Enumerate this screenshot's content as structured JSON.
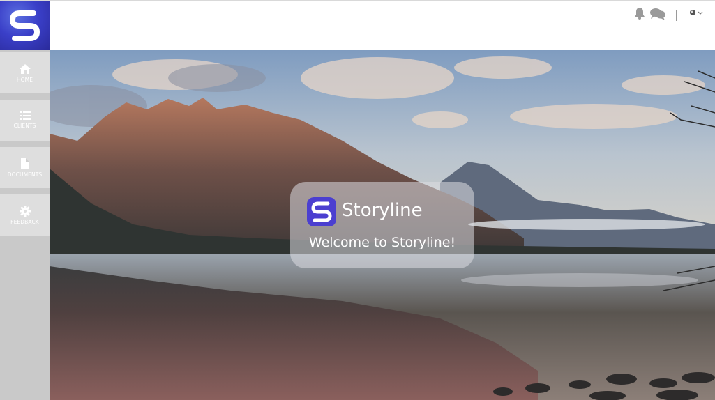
{
  "app": {
    "logo_icon": "storyline-logo-icon",
    "brand_color": "#3a3fc8"
  },
  "header": {
    "notifications_icon": "bell-icon",
    "messages_icon": "chat-bubbles-icon",
    "user_icon": "user-avatar-icon",
    "user_menu_icon": "chevron-down-icon"
  },
  "sidebar": {
    "items": [
      {
        "label": "HOME",
        "icon": "home-icon"
      },
      {
        "label": "CLIENTS",
        "icon": "list-icon"
      },
      {
        "label": "DOCUMENTS",
        "icon": "document-icon"
      },
      {
        "label": "FEEDBACK",
        "icon": "gear-icon"
      }
    ]
  },
  "welcome": {
    "title": "Storyline",
    "subtitle": "Welcome to Storyline!"
  }
}
